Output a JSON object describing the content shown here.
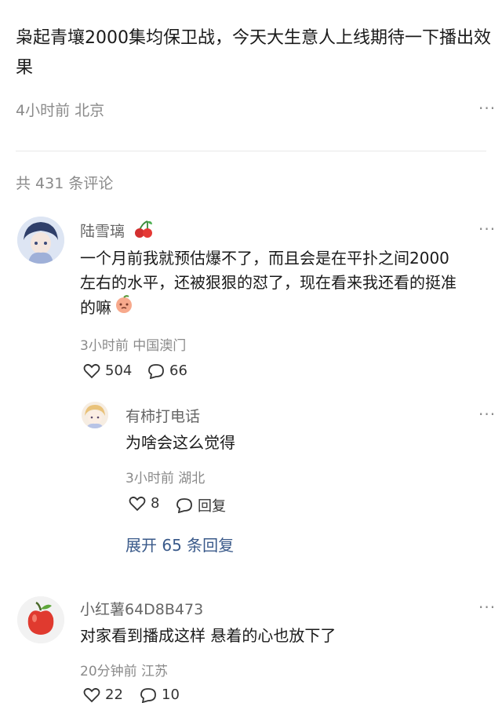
{
  "post": {
    "title": "枭起青壤2000集均保卫战，今天大生意人上线期待一下播出效果",
    "time": "4小时前",
    "location": "北京",
    "more": "···"
  },
  "comments_count_label": "共 431 条评论",
  "comments": [
    {
      "name": "陆雪璃",
      "badge": "cherry-icon",
      "content_line1": "一个月前我就预估爆不了，而且会是在平扑之间2000",
      "content_line2": "左右的水平，还被狠狠的怼了，现在看来我还看的挺准",
      "content_line3": "的嘛",
      "emoji": "peach-face-emoji",
      "time": "3小时前",
      "location": "中国澳门",
      "likes": "504",
      "replies": "66",
      "reply": {
        "name": "有柿打电话",
        "content": "为啥会这么觉得",
        "time": "3小时前",
        "location": "湖北",
        "likes": "8",
        "reply_label": "回复"
      },
      "expand_label": "展开 65 条回复"
    },
    {
      "name": "小红薯64D8B473",
      "content": "对家看到播成这样 悬着的心也放下了",
      "time": "20分钟前",
      "location": "江苏",
      "likes": "22",
      "replies": "10"
    }
  ],
  "colors": {
    "accent": "#3a5a8a",
    "meta": "#8a8a8a",
    "divider": "#e8e8e8"
  }
}
